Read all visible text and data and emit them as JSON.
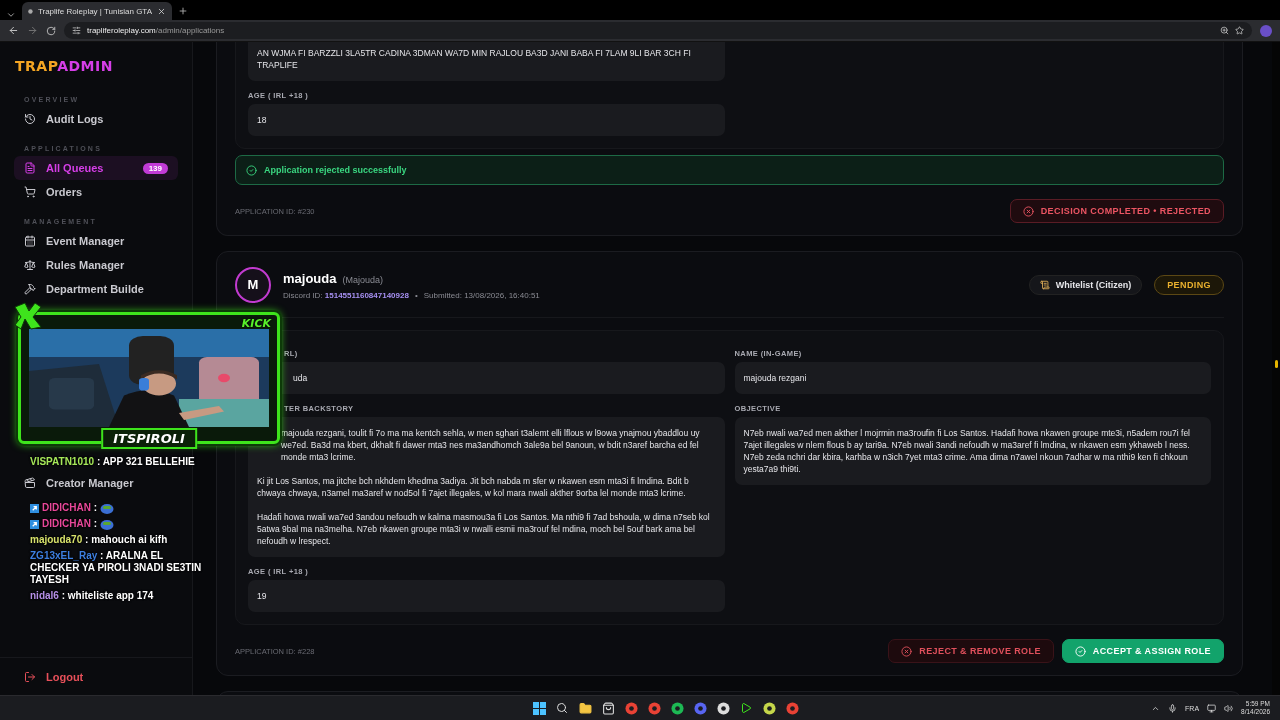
{
  "browser": {
    "tab_title": "Traplife Roleplay | Tunisian GTA",
    "url_host": "trapliferoleplay.com",
    "url_path": "/admin/applications"
  },
  "sidebar": {
    "logo_primary": "TRAP",
    "logo_accent": "ADMIN",
    "sections": [
      {
        "title": "OVERVIEW",
        "items": [
          {
            "label": "Audit Logs",
            "selected": false
          }
        ]
      },
      {
        "title": "APPLICATIONS",
        "items": [
          {
            "label": "All Queues",
            "selected": true,
            "count": "139"
          },
          {
            "label": "Orders",
            "selected": false
          }
        ]
      },
      {
        "title": "MANAGEMENT",
        "items": [
          {
            "label": "Event Manager",
            "selected": false
          },
          {
            "label": "Rules Manager",
            "selected": false
          },
          {
            "label": "Department Builde",
            "selected": false
          },
          {
            "label": "Creator Manager",
            "selected": false
          }
        ]
      }
    ],
    "logout": "Logout"
  },
  "applications": [
    {
      "fields": [
        {
          "value": "AN WJMA FI BARZZLI 3LA5TR CADINA 3DMAN WA7D MIN RAJLOU BA3D JANI BABA FI 7LAM 9LI BAR 3CH FI TRAPLIFE"
        },
        {
          "label": "AGE ( IRL +18 )",
          "value": "18"
        }
      ],
      "alert": "Application rejected successfully",
      "application_id": "APPLICATION ID: #230",
      "decision": {
        "label": "DECISION COMPLETED • REJECTED",
        "kind": "rejected"
      }
    },
    {
      "avatar": "M",
      "name": "majouda",
      "alias": "(Majouda)",
      "discord_label": "Discord ID:",
      "discord_id": "1514551160847140928",
      "separator": "•",
      "submitted": "Submitted: 13/08/2026, 16:40:51",
      "type": "Whitelist (Citizen)",
      "status": {
        "label": "PENDING",
        "kind": "pending"
      },
      "left_fields": [
        {
          "label": "RL)",
          "value": "uda"
        },
        {
          "label": "TER BACKSTORY",
          "paragraphs": [
            "majouda rezgani, toulit fi 7o ma ma kentch sehla, w men sghari t3alemt elli lflous w l9owa ynajmou ybaddlou uy we7ed. Ba3d ma kbert, dkhalt fi dawer mta3 nes ma3andhomch 3ale9a bel 9anoun, w bdit n3aref barcha ed fel monde mta3 lcrime.",
            "Ki jit Los Santos, ma jitche bch nkhdem khedma 3adiya. Jit bch nabda m sfer w nkawen esm mta3i fi lmdina. Bdit b chwaya chwaya, n3amel ma3aref w nod5ol fi 7ajet illegales, w kol mara nwali akther 9orba lel monde mta3 lcrime.",
            "Hadafi howa nwali wa7ed 3andou nefoudh w kalma masmou3a fi Los Santos. Ma nthi9 fi 7ad bshoula, w dima n7seb kol 5atwa 9bal ma na3melha. N7eb nkawen groupe mta3i w nwalli esmii ma3rouf fel mdina, moch bel 5ouf bark ama bel nefoudh w lrespect."
          ]
        },
        {
          "label": "AGE ( IRL +18 )",
          "value": "19"
        }
      ],
      "right_fields": [
        {
          "label": "NAME (IN-GAME)",
          "value": "majouda rezgani"
        },
        {
          "label": "OBJECTIVE",
          "paragraphs": [
            "N7eb nwali wa7ed men akther l mojrmin ma3roufin fi Los Santos. Hadafi howa nkawen groupe mte3i, n5adem rou7i fel 7ajet illegales w nlem flous b ay tari9a. N7eb nwali 3andi nefoudh w ma3aref fi lmdina, w nkawen esm ykhaweb l ness. N7eb zeda nchri dar kbira, karhba  w n3ich 7yet mta3 crime. Ama dima n7awel nkoun 7adhar w ma nthi9 ken fi chkoun yesta7a9 thi9ti."
          ]
        }
      ],
      "application_id": "APPLICATION ID: #228",
      "actions": [
        {
          "label": "REJECT & REMOVE ROLE",
          "kind": "reject"
        },
        {
          "label": "ACCEPT & ASSIGN ROLE",
          "kind": "accept"
        }
      ]
    }
  ],
  "stream_overlay": {
    "platform": "KICK",
    "streamer": "ITSPIROLI",
    "chat": [
      {
        "user": "VISPATN1010",
        "color": "#a6e85a",
        "text": ": APP 321 BELLEHIE",
        "badge": false,
        "emote": false
      },
      {
        "user": "DIDICHAN",
        "color": "#e8489a",
        "text": ":",
        "badge": true,
        "emote": true
      },
      {
        "user": "DIDICHAN",
        "color": "#e8489a",
        "text": ":",
        "badge": true,
        "emote": true
      },
      {
        "user": "majouda70",
        "color": "#d9e36c",
        "text": ": mahouch ai kifh",
        "badge": false,
        "emote": false
      },
      {
        "user": "ZG13xEL_Ray",
        "color": "#3d7fe0",
        "text": ": ARALNA EL CHECKER YA PIROLI 3NADI SE3TIN TAYESH",
        "badge": false,
        "emote": false
      },
      {
        "user": "nidal6",
        "color": "#b58fe6",
        "text": ": whiteliste app 174",
        "badge": false,
        "emote": false
      }
    ]
  },
  "taskbar": {
    "language": "FRA",
    "time": "5:59 PM",
    "date": "8/14/2026"
  }
}
